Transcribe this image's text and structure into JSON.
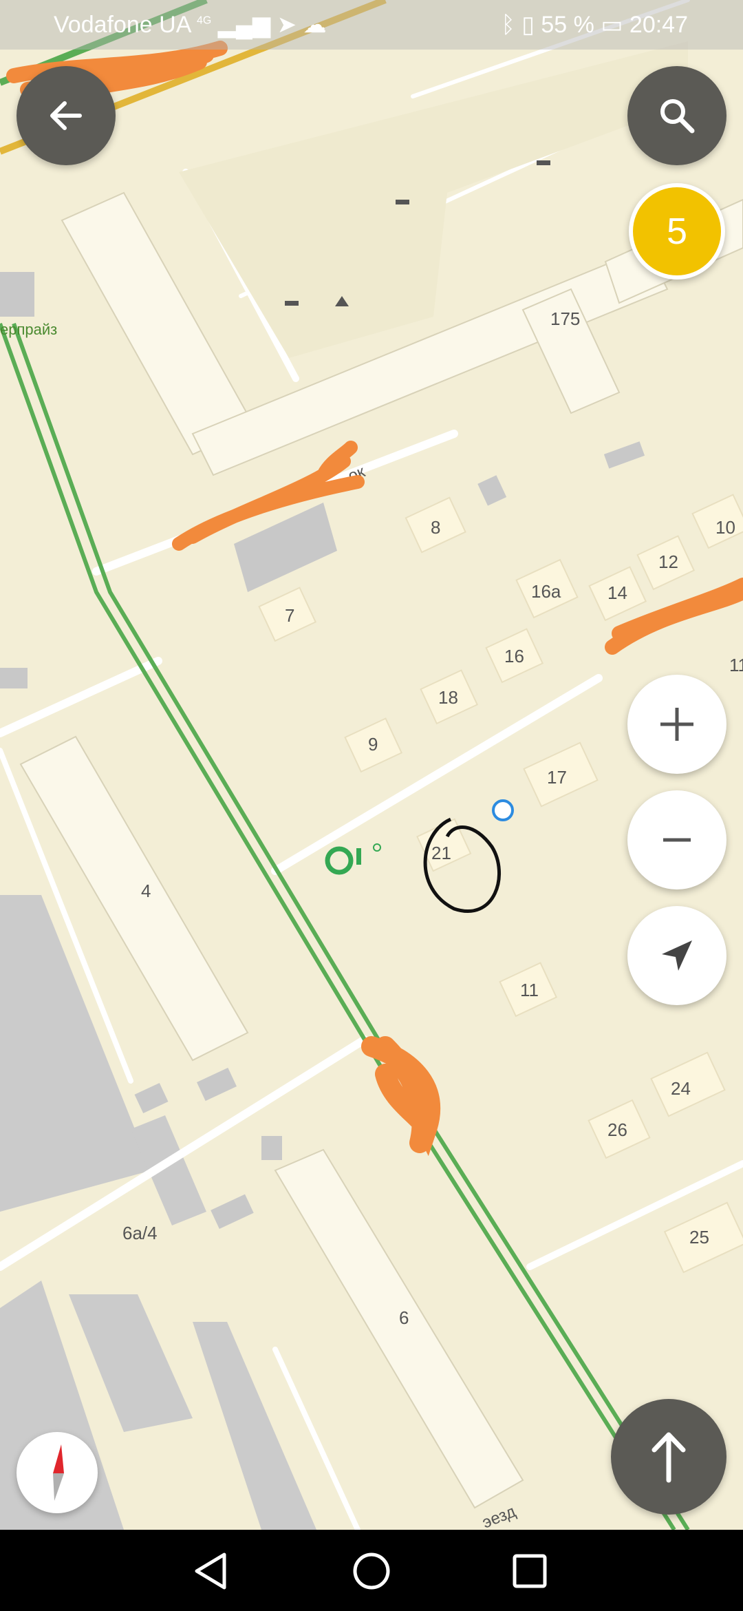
{
  "status_bar": {
    "carrier": "Vodafone UA",
    "network": "4G",
    "battery": "55 %",
    "time": "20:47"
  },
  "map": {
    "poi_label": "ерпрайз",
    "street_labels": [
      "ок",
      "эезд"
    ],
    "building_numbers": [
      "175",
      "8",
      "10",
      "12",
      "14",
      "16а",
      "16",
      "7",
      "18",
      "9",
      "17",
      "21",
      "4",
      "11",
      "24",
      "26",
      "25",
      "6а/4",
      "6",
      "11"
    ]
  },
  "controls": {
    "back": "back",
    "search": "search",
    "layers_count": "5",
    "zoom_in": "+",
    "zoom_out": "−",
    "locate": "my-location",
    "compass": "compass",
    "route": "route-arrow"
  },
  "colors": {
    "map_bg": "#f3eed6",
    "building": "#fbf8ea",
    "road": "#e6e0c8",
    "green_route": "#5aad55",
    "annotation_orange": "#f28a3c",
    "badge_yellow": "#f2c200"
  }
}
